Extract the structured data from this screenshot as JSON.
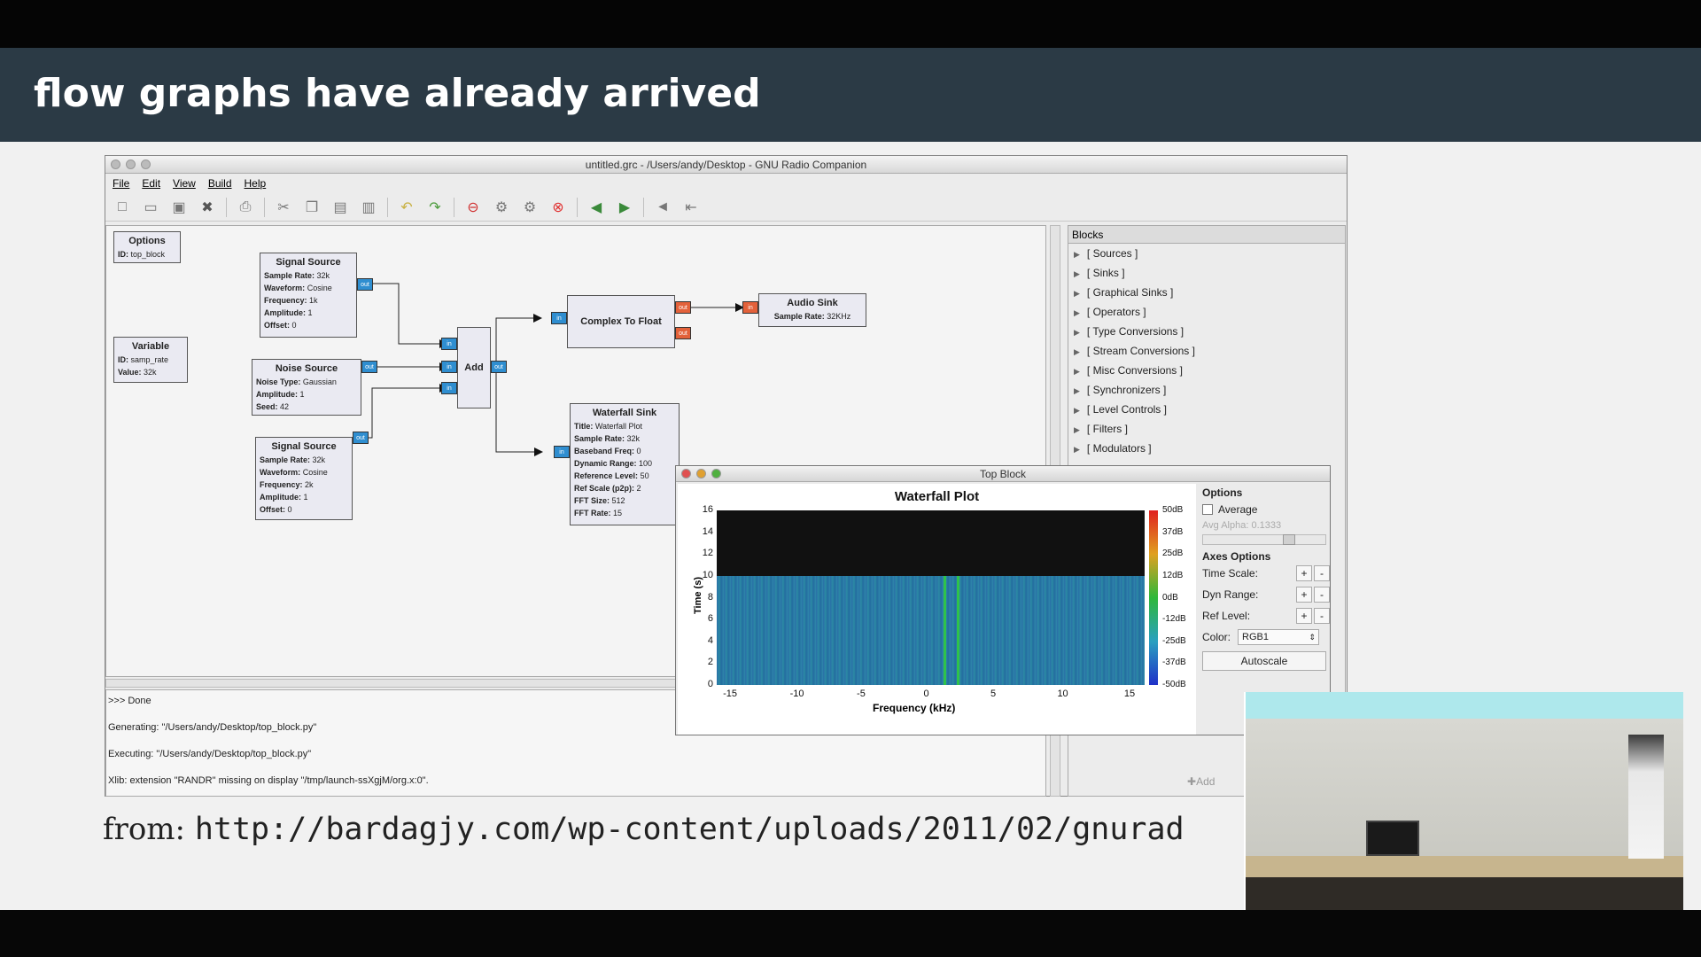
{
  "slide": {
    "title": "flow graphs have already arrived",
    "from_prefix": "from:",
    "from_url": "http://bardagjy.com/wp-content/uploads/2011/02/gnurad"
  },
  "window": {
    "title": "untitled.grc - /Users/andy/Desktop - GNU Radio Companion",
    "menu": [
      "File",
      "Edit",
      "View",
      "Build",
      "Help"
    ]
  },
  "toolbar_icons": [
    "new-icon",
    "open-icon",
    "save-icon",
    "close-icon",
    "print-icon",
    "cut-icon",
    "copy-icon",
    "paste-icon",
    "delete-icon",
    "undo-icon",
    "redo-icon",
    "disable-icon",
    "generate-icon",
    "execute-icon",
    "kill-icon",
    "rotate-left-icon",
    "rotate-right-icon",
    "enable-icon",
    "bypass-icon"
  ],
  "canvas_blocks": {
    "options": {
      "title": "Options",
      "l1": "ID:",
      "v1": "top_block"
    },
    "variable": {
      "title": "Variable",
      "l1": "ID:",
      "v1": "samp_rate",
      "l2": "Value:",
      "v2": "32k"
    },
    "signal1": {
      "title": "Signal Source",
      "rows": [
        [
          "Sample Rate:",
          "32k"
        ],
        [
          "Waveform:",
          "Cosine"
        ],
        [
          "Frequency:",
          "1k"
        ],
        [
          "Amplitude:",
          "1"
        ],
        [
          "Offset:",
          "0"
        ]
      ]
    },
    "noise": {
      "title": "Noise Source",
      "rows": [
        [
          "Noise Type:",
          "Gaussian"
        ],
        [
          "Amplitude:",
          "1"
        ],
        [
          "Seed:",
          "42"
        ]
      ]
    },
    "signal2": {
      "title": "Signal Source",
      "rows": [
        [
          "Sample Rate:",
          "32k"
        ],
        [
          "Waveform:",
          "Cosine"
        ],
        [
          "Frequency:",
          "2k"
        ],
        [
          "Amplitude:",
          "1"
        ],
        [
          "Offset:",
          "0"
        ]
      ]
    },
    "add": {
      "title": "Add"
    },
    "c2f": {
      "title": "Complex To Float"
    },
    "audio": {
      "title": "Audio Sink",
      "l1": "Sample Rate:",
      "v1": "32KHz"
    },
    "waterfall": {
      "title": "Waterfall Sink",
      "rows": [
        [
          "Title:",
          "Waterfall Plot"
        ],
        [
          "Sample Rate:",
          "32k"
        ],
        [
          "Baseband Freq:",
          "0"
        ],
        [
          "Dynamic Range:",
          "100"
        ],
        [
          "Reference Level:",
          "50"
        ],
        [
          "Ref Scale (p2p):",
          "2"
        ],
        [
          "FFT Size:",
          "512"
        ],
        [
          "FFT Rate:",
          "15"
        ]
      ]
    },
    "ports": {
      "in": "in",
      "out": "out"
    }
  },
  "console": {
    "lines": [
      ">>> Done",
      "Generating: \"/Users/andy/Desktop/top_block.py\"",
      "Executing: \"/Users/andy/Desktop/top_block.py\"",
      "Xlib:  extension \"RANDR\" missing on display \"/tmp/launch-ssXgjM/org.x:0\"."
    ]
  },
  "blocks_panel": {
    "header": "Blocks",
    "items": [
      "[ Sources ]",
      "[ Sinks ]",
      "[ Graphical Sinks ]",
      "[ Operators ]",
      "[ Type Conversions ]",
      "[ Stream Conversions ]",
      "[ Misc Conversions ]",
      "[ Synchronizers ]",
      "[ Level Controls ]",
      "[ Filters ]",
      "[ Modulators ]"
    ],
    "add_label": "Add"
  },
  "top_block": {
    "title": "Top Block",
    "plot_title": "Waterfall Plot",
    "y_label": "Time (s)",
    "x_label": "Frequency (kHz)",
    "y_ticks": [
      "16",
      "14",
      "12",
      "10",
      "8",
      "6",
      "4",
      "2",
      "0"
    ],
    "x_ticks": [
      "-15",
      "-10",
      "-5",
      "0",
      "5",
      "10",
      "15"
    ],
    "color_ticks": [
      "50dB",
      "37dB",
      "25dB",
      "12dB",
      "0dB",
      "-12dB",
      "-25dB",
      "-37dB",
      "-50dB"
    ],
    "options": {
      "heading": "Options",
      "average_label": "Average",
      "avg_alpha": "Avg Alpha: 0.1333",
      "axes_heading": "Axes Options",
      "time_scale": "Time Scale:",
      "dyn_range": "Dyn Range:",
      "ref_level": "Ref Level:",
      "color_label": "Color:",
      "color_value": "RGB1",
      "autoscale": "Autoscale",
      "plus": "+",
      "minus": "-"
    }
  },
  "chart_data": {
    "type": "heatmap",
    "title": "Waterfall Plot",
    "xlabel": "Frequency (kHz)",
    "ylabel": "Time (s)",
    "xlim": [
      -16,
      16
    ],
    "ylim": [
      0,
      16
    ],
    "x_ticks": [
      -15,
      -10,
      -5,
      0,
      5,
      10,
      15
    ],
    "y_ticks": [
      0,
      2,
      4,
      6,
      8,
      10,
      12,
      14,
      16
    ],
    "colorbar_range_db": [
      -50,
      50
    ],
    "filled_time_range": [
      0,
      10
    ],
    "signal_lines_khz": [
      1,
      2
    ]
  }
}
